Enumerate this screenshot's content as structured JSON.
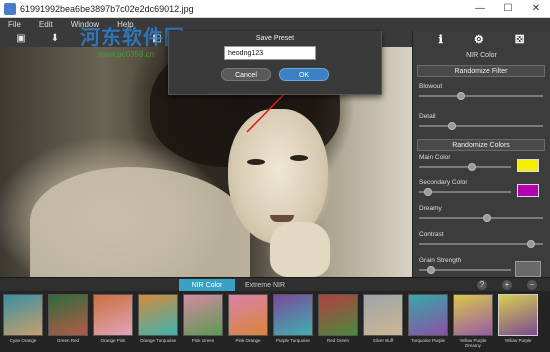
{
  "window": {
    "title": "61991992bea6be3897b7c02e2dc69012.jpg",
    "minimize": "—",
    "maximize": "☐",
    "close": "✕"
  },
  "menu": [
    "File",
    "Edit",
    "Window",
    "Help"
  ],
  "watermark": {
    "line1": "河东软件园",
    "line2": "www.pc0359.cn"
  },
  "dialog": {
    "title": "Save Preset",
    "input_value": "heodng123",
    "cancel_label": "Cancel",
    "ok_label": "OK"
  },
  "panel": {
    "icons": [
      "info-icon",
      "settings-icon",
      "dice-icon"
    ],
    "title": "NIR Color",
    "randomize_filter": "Randomize Filter",
    "randomize_colors": "Randomize Colors",
    "sliders": [
      {
        "label": "Blowout",
        "value": 0.33
      },
      {
        "label": "Detail",
        "value": 0.25
      },
      {
        "label": "Main Color",
        "value": 0.58
      },
      {
        "label": "Secondary Color",
        "value": 0.06
      },
      {
        "label": "Dreamy",
        "value": 0.55
      },
      {
        "label": "Contrast",
        "value": 0.93
      },
      {
        "label": "Grain Strength",
        "value": 0.1
      }
    ],
    "main_color": "#f2ef00",
    "secondary_color": "#b000b0"
  },
  "tabs": {
    "nir_color": "NIR Color",
    "extreme_nir": "Extreme NIR"
  },
  "presets": [
    {
      "label": "Cyan Orange",
      "colors": [
        "#3b8ea2",
        "#c7a069"
      ]
    },
    {
      "label": "Green Red",
      "colors": [
        "#2f6c3a",
        "#b55a4a"
      ]
    },
    {
      "label": "Orange Pink",
      "colors": [
        "#c9703e",
        "#e1a4b8"
      ]
    },
    {
      "label": "Orange Turquoise",
      "colors": [
        "#d68a3e",
        "#3cb3b0"
      ]
    },
    {
      "label": "Pink Green",
      "colors": [
        "#d58aa4",
        "#5a9a50"
      ]
    },
    {
      "label": "Pink Orange",
      "colors": [
        "#d983a8",
        "#d9843a"
      ]
    },
    {
      "label": "Purple Turquoise",
      "colors": [
        "#7b4a9a",
        "#3fb0b0"
      ]
    },
    {
      "label": "Red Green",
      "colors": [
        "#b34040",
        "#4a8a3e"
      ]
    },
    {
      "label": "Silver Buff",
      "colors": [
        "#9ea4a8",
        "#cdb896"
      ]
    },
    {
      "label": "Turquoise Purple",
      "colors": [
        "#38a8a8",
        "#8a50a8"
      ]
    },
    {
      "label": "Yellow Purple Dreamy",
      "colors": [
        "#d8c84a",
        "#9a5aa8"
      ]
    },
    {
      "label": "Yellow Purple",
      "colors": [
        "#d9cf50",
        "#7a4a90"
      ]
    }
  ]
}
